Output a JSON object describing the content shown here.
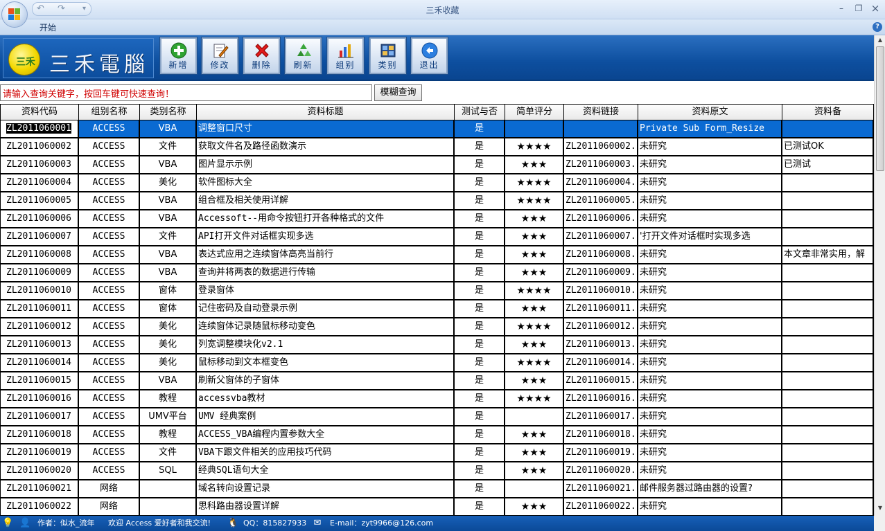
{
  "window": {
    "title": "三禾收藏",
    "minimize": "–",
    "restore": "❐",
    "close": "×"
  },
  "qat": {
    "undo": "↶",
    "redo": "↷",
    "more": "▾"
  },
  "ribbon": {
    "tab_start": "开始",
    "help": "?"
  },
  "brand": {
    "logo_text": "三禾",
    "name": "三禾電腦"
  },
  "toolbar": {
    "buttons": [
      {
        "label": "新增",
        "icon": "add-icon"
      },
      {
        "label": "修改",
        "icon": "edit-icon"
      },
      {
        "label": "删除",
        "icon": "delete-icon"
      },
      {
        "label": "刷新",
        "icon": "refresh-icon"
      },
      {
        "label": "组别",
        "icon": "group-icon"
      },
      {
        "label": "类别",
        "icon": "category-icon"
      },
      {
        "label": "退出",
        "icon": "exit-icon"
      }
    ]
  },
  "search": {
    "placeholder": "请输入查询关键字，按回车键可快速查询！",
    "button": "模糊查询"
  },
  "table": {
    "columns": [
      "资料代码",
      "组别名称",
      "类别名称",
      "资料标题",
      "测试与否",
      "简单评分",
      "资料链接",
      "资料原文",
      "资料备"
    ],
    "rows": [
      [
        "ZL2011060001",
        "ACCESS",
        "VBA",
        "调整窗口尺寸",
        "是",
        "",
        "",
        "Private Sub Form_Resize",
        ""
      ],
      [
        "ZL2011060002",
        "ACCESS",
        "文件",
        "获取文件名及路径函数演示",
        "是",
        "★★★★",
        "ZL2011060002.",
        "未研究",
        "已测试OK"
      ],
      [
        "ZL2011060003",
        "ACCESS",
        "VBA",
        "图片显示示例",
        "是",
        "★★★",
        "ZL2011060003.",
        "未研究",
        "已测试"
      ],
      [
        "ZL2011060004",
        "ACCESS",
        "美化",
        "软件图标大全",
        "是",
        "★★★★",
        "ZL2011060004.",
        "未研究",
        ""
      ],
      [
        "ZL2011060005",
        "ACCESS",
        "VBA",
        "组合框及相关使用详解",
        "是",
        "★★★★",
        "ZL2011060005.",
        "未研究",
        ""
      ],
      [
        "ZL2011060006",
        "ACCESS",
        "VBA",
        "Accessoft--用命令按钮打开各种格式的文件",
        "是",
        "★★★",
        "ZL2011060006.",
        "未研究",
        ""
      ],
      [
        "ZL2011060007",
        "ACCESS",
        "文件",
        "API打开文件对话框实现多选",
        "是",
        "★★★",
        "ZL2011060007.",
        "'打开文件对话框时实现多选",
        ""
      ],
      [
        "ZL2011060008",
        "ACCESS",
        "VBA",
        "表达式应用之连续窗体高亮当前行",
        "是",
        "★★★",
        "ZL2011060008.",
        "未研究",
        "本文章非常实用，解"
      ],
      [
        "ZL2011060009",
        "ACCESS",
        "VBA",
        "查询并将两表的数据进行传输",
        "是",
        "★★★",
        "ZL2011060009.",
        "未研究",
        ""
      ],
      [
        "ZL2011060010",
        "ACCESS",
        "窗体",
        "登录窗体",
        "是",
        "★★★★",
        "ZL2011060010.",
        "未研究",
        ""
      ],
      [
        "ZL2011060011",
        "ACCESS",
        "窗体",
        "记住密码及自动登录示例",
        "是",
        "★★★",
        "ZL2011060011.",
        "未研究",
        ""
      ],
      [
        "ZL2011060012",
        "ACCESS",
        "美化",
        "连续窗体记录随鼠标移动变色",
        "是",
        "★★★★",
        "ZL2011060012.",
        "未研究",
        ""
      ],
      [
        "ZL2011060013",
        "ACCESS",
        "美化",
        "列宽调整模块化v2.1",
        "是",
        "★★★",
        "ZL2011060013.",
        "未研究",
        ""
      ],
      [
        "ZL2011060014",
        "ACCESS",
        "美化",
        "鼠标移动到文本框变色",
        "是",
        "★★★★",
        "ZL2011060014.",
        "未研究",
        ""
      ],
      [
        "ZL2011060015",
        "ACCESS",
        "VBA",
        "刷新父窗体的子窗体",
        "是",
        "★★★",
        "ZL2011060015.",
        "未研究",
        ""
      ],
      [
        "ZL2011060016",
        "ACCESS",
        "教程",
        "accessvba教材",
        "是",
        "★★★★",
        "ZL2011060016.",
        "未研究",
        ""
      ],
      [
        "ZL2011060017",
        "ACCESS",
        "UMV平台",
        "UMV 经典案例",
        "是",
        "",
        "ZL2011060017.",
        "未研究",
        ""
      ],
      [
        "ZL2011060018",
        "ACCESS",
        "教程",
        "ACCESS_VBA编程内置参数大全",
        "是",
        "★★★",
        "ZL2011060018.",
        "未研究",
        ""
      ],
      [
        "ZL2011060019",
        "ACCESS",
        "文件",
        "VBA下跟文件相关的应用技巧代码",
        "是",
        "★★★",
        "ZL2011060019.",
        "未研究",
        ""
      ],
      [
        "ZL2011060020",
        "ACCESS",
        "SQL",
        "经典SQL语句大全",
        "是",
        "★★★",
        "ZL2011060020.",
        "未研究",
        ""
      ],
      [
        "ZL2011060021",
        "网络",
        "",
        "域名转向设置记录",
        "是",
        "",
        "ZL2011060021.",
        "邮件服务器过路由器的设置?",
        ""
      ],
      [
        "ZL2011060022",
        "网络",
        "",
        "思科路由器设置详解",
        "是",
        "★★★",
        "ZL2011060022.",
        "未研究",
        ""
      ]
    ],
    "selected_row": 0
  },
  "status": {
    "author": "作者：似水_流年",
    "welcome": "欢迎 Access 爱好者和我交流!",
    "qq": "QQ：815827933",
    "email": "E-mail：zyt9966@126.com"
  },
  "colors": {
    "toolbar_blue": "#0d4f9f",
    "selection_blue": "#0a6ad2",
    "search_text_red": "#d00000",
    "status_blue": "#0b4a98"
  }
}
